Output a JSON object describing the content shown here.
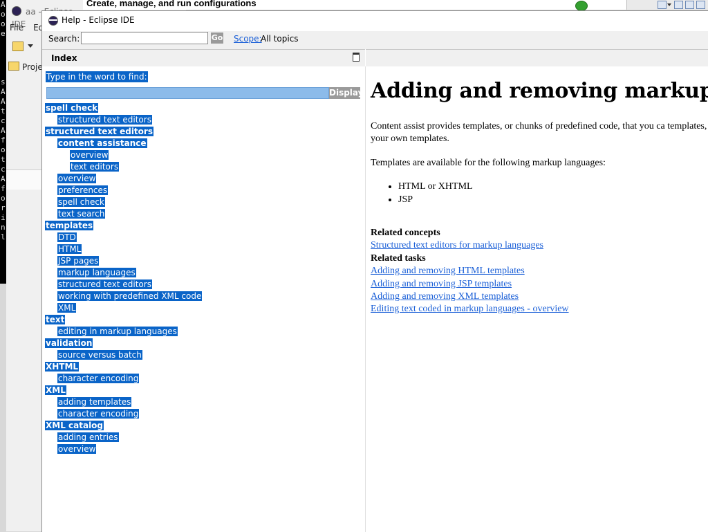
{
  "background_window": {
    "title": "aa - Eclipse IDE",
    "menu": [
      "File",
      "Edi"
    ],
    "project_tab": "Proje",
    "launch_title": "Create, manage, and run configurations",
    "left_strip_chars": [
      "A",
      "o",
      "o",
      "e",
      "",
      "",
      "",
      "",
      "s",
      "A",
      "A",
      "t",
      "c",
      "A",
      "f",
      "o",
      "t",
      "c",
      "A",
      "f",
      "o",
      "r",
      "i",
      "n",
      "l"
    ]
  },
  "help_window": {
    "title": "Help - Eclipse IDE",
    "search": {
      "label": "Search:",
      "value": "",
      "go_label": "Go",
      "scope_link": "Scope:",
      "scope_value": "All topics"
    },
    "index_panel": {
      "title": "Index",
      "find_label": "Type in the word to find:",
      "find_value": "",
      "display_label": "Display",
      "entries": [
        {
          "label": "spell check",
          "level": 0
        },
        {
          "label": "structured text editors",
          "level": 1
        },
        {
          "label": "structured text editors",
          "level": 0
        },
        {
          "label": "content assistance",
          "level": 1,
          "bold": true
        },
        {
          "label": "overview",
          "level": 2
        },
        {
          "label": "text editors",
          "level": 2
        },
        {
          "label": "overview",
          "level": 1
        },
        {
          "label": "preferences",
          "level": 1
        },
        {
          "label": "spell check",
          "level": 1
        },
        {
          "label": "text search",
          "level": 1
        },
        {
          "label": "templates",
          "level": 0
        },
        {
          "label": "DTD",
          "level": 1
        },
        {
          "label": "HTML",
          "level": 1
        },
        {
          "label": "JSP pages",
          "level": 1
        },
        {
          "label": "markup languages",
          "level": 1
        },
        {
          "label": "structured text editors",
          "level": 1
        },
        {
          "label": "working with predefined XML code",
          "level": 1
        },
        {
          "label": "XML",
          "level": 1
        },
        {
          "label": "text",
          "level": 0
        },
        {
          "label": "editing in markup languages",
          "level": 1
        },
        {
          "label": "validation",
          "level": 0
        },
        {
          "label": "source versus batch",
          "level": 1
        },
        {
          "label": "XHTML",
          "level": 0
        },
        {
          "label": "character encoding",
          "level": 1
        },
        {
          "label": "XML",
          "level": 0
        },
        {
          "label": "adding templates",
          "level": 1
        },
        {
          "label": "character encoding",
          "level": 1
        },
        {
          "label": "XML catalog",
          "level": 0
        },
        {
          "label": "adding entries",
          "level": 1
        },
        {
          "label": "overview",
          "level": 1
        }
      ]
    },
    "content": {
      "title": "Adding and removing markup langu",
      "para1": "Content assist provides templates, or chunks of predefined code, that you ca templates, or create your own templates.",
      "para2": "Templates are available for the following markup languages:",
      "list": [
        "HTML or XHTML",
        "JSP"
      ],
      "related_concepts_heading": "Related concepts",
      "related_concepts": [
        "Structured text editors for markup languages"
      ],
      "related_tasks_heading": "Related tasks",
      "related_tasks": [
        "Adding and removing HTML templates",
        "Adding and removing JSP templates",
        "Adding and removing XML templates",
        "Editing text coded in markup languages - overview"
      ]
    }
  }
}
